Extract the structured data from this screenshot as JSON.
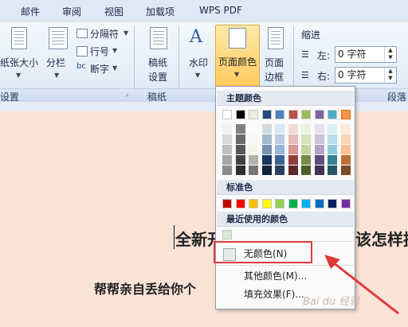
{
  "menubar": {
    "items": [
      "邮件",
      "审阅",
      "视图",
      "加载项",
      "WPS PDF"
    ]
  },
  "ribbon": {
    "page_setup": {
      "paper_size": "纸张大小",
      "columns": "分栏",
      "separator": "分隔符",
      "line_numbers": "行号",
      "hyphenation": "断字",
      "group_label": "设置"
    },
    "manuscript": {
      "button_line1": "稿纸",
      "button_line2": "设置",
      "group_label": "稿纸"
    },
    "background": {
      "watermark": "水印",
      "page_color": "页面颜色",
      "page_border_line1": "页面",
      "page_border_line2": "边框"
    },
    "paragraph": {
      "indent_label": "缩进",
      "left_label": "左:",
      "left_value": "0 字符",
      "right_label": "右:",
      "right_value": "0 字符",
      "group_label": "段落"
    }
  },
  "document": {
    "line1_left": "全新开",
    "line1_right": "该怎样提",
    "line2": "帮帮亲自丢给你个"
  },
  "color_panel": {
    "theme_header": "主题颜色",
    "standard_header": "标准色",
    "recent_header": "最近使用的颜色",
    "no_color": "无颜色(N)",
    "more_colors": "其他颜色(M)...",
    "fill_effects": "填充效果(F)...",
    "theme_colors": [
      "#ffffff",
      "#000000",
      "#eeece1",
      "#1f497d",
      "#4f81bd",
      "#c0504d",
      "#9bbb59",
      "#8064a2",
      "#4bacc6",
      "#f79646"
    ],
    "standard_colors": [
      "#c00000",
      "#ff0000",
      "#ffc000",
      "#ffff00",
      "#92d050",
      "#00b050",
      "#00b0f0",
      "#0070c0",
      "#002060",
      "#7030a0"
    ],
    "recent_colors": [
      "#d8ecd4"
    ]
  },
  "watermark_text": "Bai du 经验"
}
